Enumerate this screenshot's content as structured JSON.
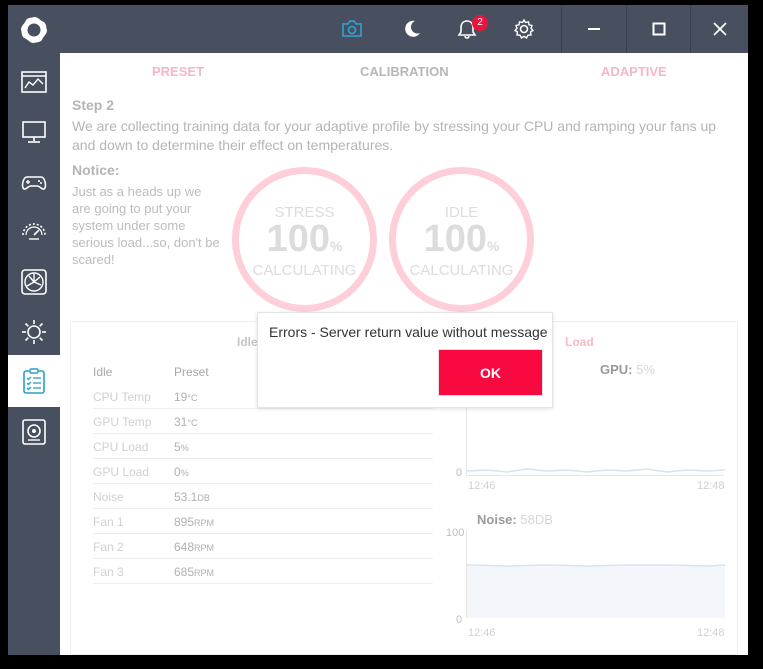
{
  "titlebar": {
    "notification_count": "2"
  },
  "tabs": [
    {
      "label": "PRESET"
    },
    {
      "label": "CALIBRATION"
    },
    {
      "label": "ADAPTIVE"
    }
  ],
  "step": {
    "title": "Step 2",
    "description": "We are collecting training data for your adaptive profile by stressing your CPU and ramping your fans up and down to determine their effect on temperatures."
  },
  "notice": {
    "title": "Notice:",
    "text": "Just as a heads up we are going to put your system under some serious load...so, don't be scared!"
  },
  "rings": [
    {
      "top": "STRESS",
      "value": "100",
      "unit": "%",
      "bottom": "CALCULATING"
    },
    {
      "top": "IDLE",
      "value": "100",
      "unit": "%",
      "bottom": "CALCULATING"
    }
  ],
  "panel": {
    "idle_heading": "Idle",
    "load_heading": "Load",
    "table_headers": [
      "Idle",
      "Preset"
    ],
    "rows": [
      {
        "label": "CPU Temp",
        "value": "19",
        "unit": "°C"
      },
      {
        "label": "GPU Temp",
        "value": "31",
        "unit": "°C"
      },
      {
        "label": "CPU Load",
        "value": "5",
        "unit": "%"
      },
      {
        "label": "GPU Load",
        "value": "0",
        "unit": "%"
      },
      {
        "label": "Noise",
        "value": "53.1",
        "unit": "DB"
      },
      {
        "label": "Fan 1",
        "value": "895",
        "unit": "RPM"
      },
      {
        "label": "Fan 2",
        "value": "648",
        "unit": "RPM"
      },
      {
        "label": "Fan 3",
        "value": "685",
        "unit": "RPM"
      }
    ],
    "gpu_graph": {
      "label": "GPU:",
      "value": "5%",
      "y_min": "0",
      "t_start": "12:46",
      "t_end": "12:48"
    },
    "noise_graph": {
      "label": "Noise:",
      "value": "58DB",
      "y_max": "100",
      "y_min": "0",
      "t_start": "12:46",
      "t_end": "12:48"
    }
  },
  "dialog": {
    "message": "Errors - Server return value without message",
    "ok_label": "OK"
  },
  "colors": {
    "sidebar": "#48505f",
    "accent": "#f80a40",
    "ring": "#ffcfd9",
    "badge": "#e8163f"
  }
}
